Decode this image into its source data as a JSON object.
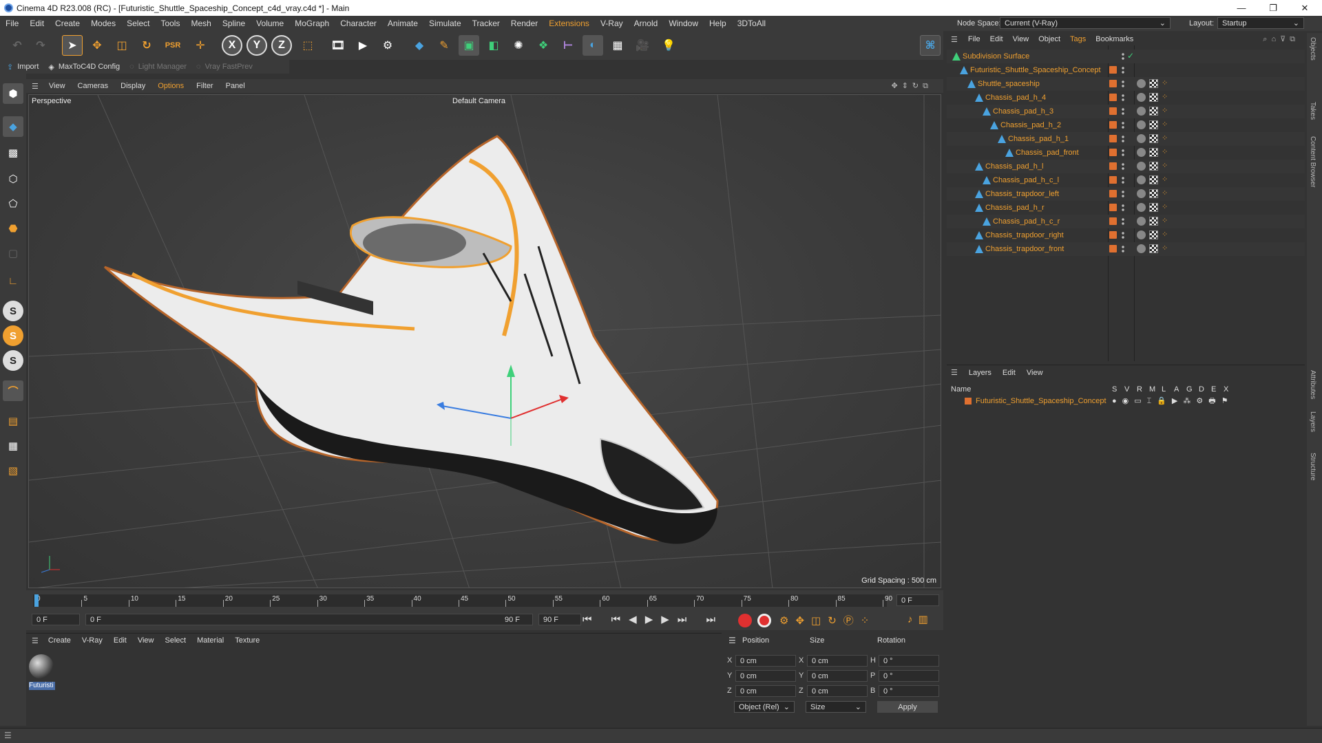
{
  "titlebar": {
    "title": "Cinema 4D R23.008 (RC) - [Futuristic_Shuttle_Spaceship_Concept_c4d_vray.c4d *] - Main",
    "min": "—",
    "max": "❐",
    "close": "✕"
  },
  "menu": [
    "File",
    "Edit",
    "Create",
    "Modes",
    "Select",
    "Tools",
    "Mesh",
    "Spline",
    "Volume",
    "MoGraph",
    "Character",
    "Animate",
    "Simulate",
    "Tracker",
    "Render",
    "Extensions",
    "V-Ray",
    "Arnold",
    "Window",
    "Help",
    "3DToAll"
  ],
  "menu_highlight": "Extensions",
  "node_space": {
    "label": "Node Space:",
    "value": "Current (V-Ray)"
  },
  "layout": {
    "label": "Layout:",
    "value": "Startup"
  },
  "subbar": {
    "import": "Import",
    "maxtoc4d": "MaxToC4D Config",
    "light_manager": "Light Manager",
    "vray_fastprev": "Vray FastPrev"
  },
  "toolbar_axes": [
    "X",
    "Y",
    "Z"
  ],
  "viewport_menu": [
    "View",
    "Cameras",
    "Display",
    "Options",
    "Filter",
    "Panel"
  ],
  "viewport_menu_highlight": "Options",
  "viewport": {
    "label": "Perspective",
    "camera": "Default Camera",
    "grid_spacing": "Grid Spacing : 500 cm"
  },
  "timeline": {
    "ticks": [
      "0",
      "5",
      "10",
      "15",
      "20",
      "25",
      "30",
      "35",
      "40",
      "45",
      "50",
      "55",
      "60",
      "65",
      "70",
      "75",
      "80",
      "85",
      "90"
    ],
    "frame_box": "0 F"
  },
  "transport": {
    "start": "0 F",
    "current": "0 F",
    "end_a": "90 F",
    "end_b": "90 F"
  },
  "material_menu": [
    "Create",
    "V-Ray",
    "Edit",
    "View",
    "Select",
    "Material",
    "Texture"
  ],
  "material": {
    "name": "Futuristi"
  },
  "attributes": {
    "headers": {
      "position": "Position",
      "size": "Size",
      "rotation": "Rotation"
    },
    "rows": [
      {
        "axis": "X",
        "pos": "0 cm",
        "saxis": "X",
        "size": "0 cm",
        "raxis": "H",
        "rot": "0 °"
      },
      {
        "axis": "Y",
        "pos": "0 cm",
        "saxis": "Y",
        "size": "0 cm",
        "raxis": "P",
        "rot": "0 °"
      },
      {
        "axis": "Z",
        "pos": "0 cm",
        "saxis": "Z",
        "size": "0 cm",
        "raxis": "B",
        "rot": "0 °"
      }
    ],
    "mode": "Object (Rel)",
    "size_mode": "Size",
    "apply": "Apply"
  },
  "object_menu": [
    "File",
    "Edit",
    "View",
    "Object",
    "Tags",
    "Bookmarks"
  ],
  "object_menu_highlight": "Tags",
  "objects": [
    {
      "name": "Subdivision Surface",
      "indent": 0,
      "green": true
    },
    {
      "name": "Futuristic_Shuttle_Spaceship_Concept",
      "indent": 1
    },
    {
      "name": "Shuttle_spaceship",
      "indent": 2
    },
    {
      "name": "Chassis_pad_h_4",
      "indent": 3
    },
    {
      "name": "Chassis_pad_h_3",
      "indent": 4
    },
    {
      "name": "Chassis_pad_h_2",
      "indent": 5
    },
    {
      "name": "Chassis_pad_h_1",
      "indent": 6
    },
    {
      "name": "Chassis_pad_front",
      "indent": 7
    },
    {
      "name": "Chassis_pad_h_l",
      "indent": 3
    },
    {
      "name": "Chassis_pad_h_c_l",
      "indent": 4
    },
    {
      "name": "Chassis_trapdoor_left",
      "indent": 3
    },
    {
      "name": "Chassis_pad_h_r",
      "indent": 3
    },
    {
      "name": "Chassis_pad_h_c_r",
      "indent": 4
    },
    {
      "name": "Chassis_trapdoor_right",
      "indent": 3
    },
    {
      "name": "Chassis_trapdoor_front",
      "indent": 3
    }
  ],
  "layers_menu": [
    "Layers",
    "Edit",
    "View"
  ],
  "layers": {
    "name_header": "Name",
    "flags": [
      "S",
      "V",
      "R",
      "M",
      "L",
      "A",
      "G",
      "D",
      "E",
      "X"
    ],
    "rows": [
      "Futuristic_Shuttle_Spaceship_Concept"
    ]
  },
  "side_tabs": [
    "Objects",
    "Takes",
    "Content Browser",
    "Attributes",
    "Layers",
    "Structure"
  ],
  "colors": {
    "accent": "#f0a030",
    "panel": "#333333",
    "bar": "#3a3a3a"
  }
}
